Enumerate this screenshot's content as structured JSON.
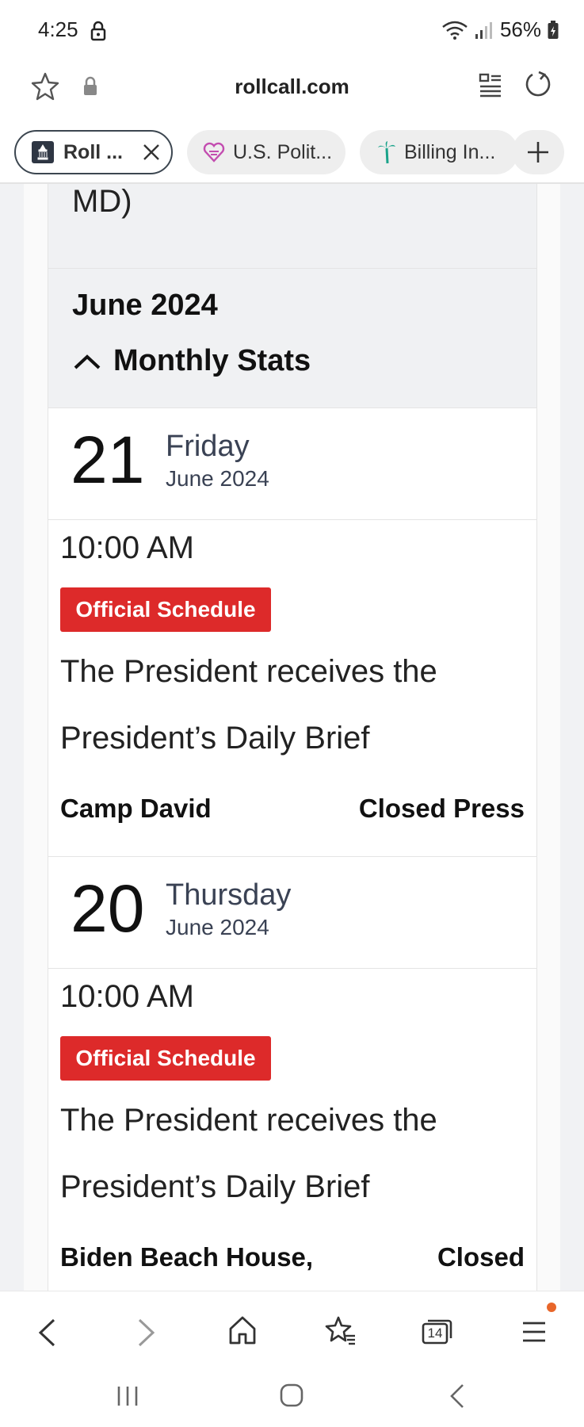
{
  "status_bar": {
    "time": "4:25",
    "battery": "56%"
  },
  "address_bar": {
    "url": "rollcall.com"
  },
  "tabs": [
    {
      "label": "Roll ..."
    },
    {
      "label": "U.S. Polit..."
    },
    {
      "label": "Billing In..."
    }
  ],
  "page": {
    "truncated_text": "MD)",
    "month_header": {
      "title": "June 2024",
      "stats_label": "Monthly Stats"
    },
    "days": [
      {
        "number": "21",
        "weekday": "Friday",
        "month": "June 2024",
        "event": {
          "time": "10:00 AM",
          "badge": "Official Schedule",
          "desc_line1": "The President receives the",
          "desc_line2": "President’s Daily Brief",
          "location": "Camp David",
          "press": "Closed Press"
        }
      },
      {
        "number": "20",
        "weekday": "Thursday",
        "month": "June 2024",
        "event": {
          "time": "10:00 AM",
          "badge": "Official Schedule",
          "desc_line1": "The President receives the",
          "desc_line2": "President’s Daily Brief",
          "location": "Biden Beach House,",
          "press": "Closed"
        }
      }
    ]
  },
  "bottom_nav": {
    "tab_count": "14"
  },
  "colors": {
    "badge": "#dd2a2a",
    "notification_dot": "#e8662a",
    "date_text": "#3a4254"
  }
}
